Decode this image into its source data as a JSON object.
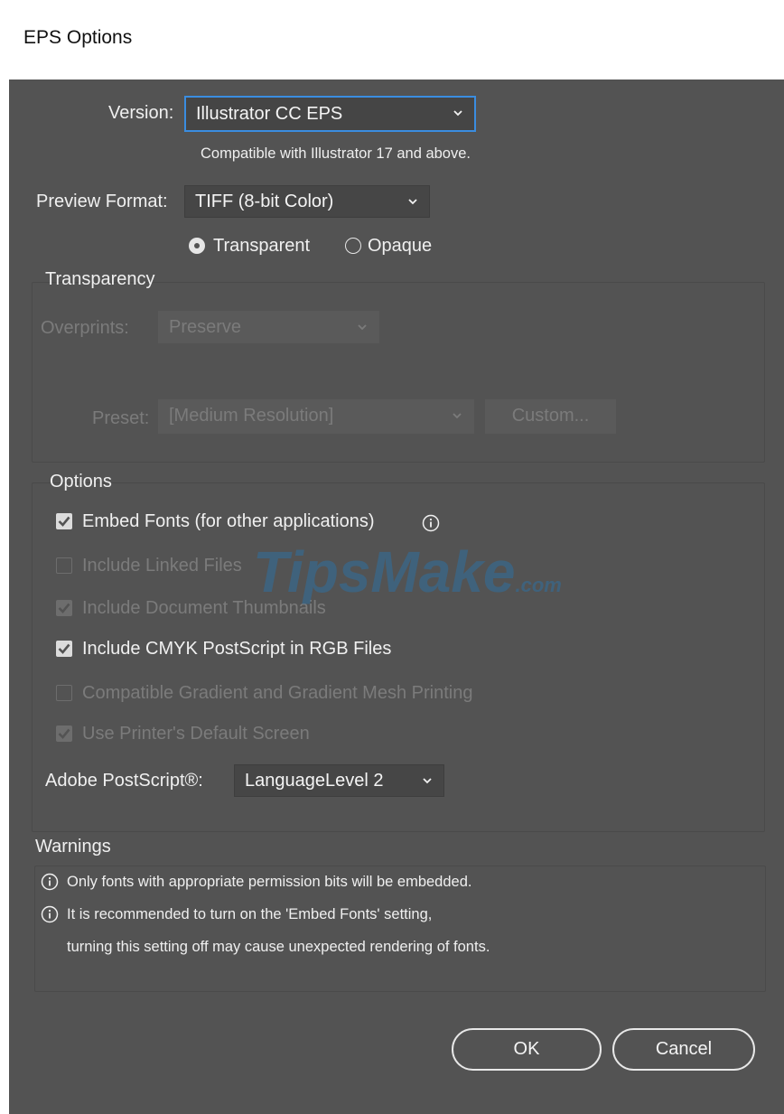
{
  "window": {
    "title": "EPS Options"
  },
  "version": {
    "label": "Version:",
    "value": "Illustrator CC EPS",
    "note": "Compatible with Illustrator 17 and above."
  },
  "preview": {
    "label": "Preview Format:",
    "value": "TIFF (8-bit Color)",
    "transparent_label": "Transparent",
    "opaque_label": "Opaque",
    "selected": "Transparent"
  },
  "transparency": {
    "heading": "Transparency",
    "overprints_label": "Overprints:",
    "overprints_value": "Preserve",
    "preset_label": "Preset:",
    "preset_value": "[Medium Resolution]",
    "custom_label": "Custom..."
  },
  "options": {
    "heading": "Options",
    "items": [
      {
        "label": "Embed Fonts (for other applications)",
        "checked": true,
        "enabled": true
      },
      {
        "label": "Include Linked Files",
        "checked": false,
        "enabled": false
      },
      {
        "label": "Include Document Thumbnails",
        "checked": true,
        "enabled": false
      },
      {
        "label": "Include CMYK PostScript in RGB Files",
        "checked": true,
        "enabled": true
      },
      {
        "label": "Compatible Gradient and Gradient Mesh Printing",
        "checked": false,
        "enabled": false
      },
      {
        "label": "Use Printer's Default Screen",
        "checked": true,
        "enabled": false
      }
    ],
    "postscript_label": "Adobe PostScript®:",
    "postscript_value": "LanguageLevel 2"
  },
  "warnings": {
    "heading": "Warnings",
    "lines": [
      "Only fonts with appropriate permission bits will be embedded.",
      "It is recommended to turn on the 'Embed Fonts' setting,",
      "turning this setting off may cause unexpected rendering of fonts."
    ]
  },
  "buttons": {
    "ok": "OK",
    "cancel": "Cancel"
  },
  "watermark": {
    "text_main": "TipsMake",
    "text_suffix": ".com"
  },
  "colors": {
    "background": "#535353",
    "focus": "#3a8de0"
  }
}
